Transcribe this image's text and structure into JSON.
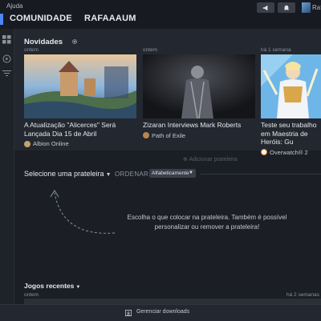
{
  "topbar": {
    "menu_label": "Ajuda",
    "nav_items": [
      "COMUNIDADE",
      "RAFAAAUM"
    ],
    "user_name": "Raf"
  },
  "news": {
    "title": "Novidades",
    "cards": [
      {
        "date": "ontem",
        "title": "A Atualização \"Alicerces\" Será Lançada Dia 15 de Abril",
        "game": "Albion Online"
      },
      {
        "date": "ontem",
        "title": "Zizaran Interviews Mark Roberts",
        "game": "Path of Exile"
      },
      {
        "date": "há 1 semana",
        "title": "Teste seu trabalho em Maestria de Heróis: Gu",
        "game": "Overwatch® 2"
      }
    ]
  },
  "shelf": {
    "add_label": "Adicionar prateleira",
    "select_label": "Selecione uma prateleira",
    "order_label": "ORDENAR:",
    "order_value": "Alfabeticamente",
    "hint": "Escolha o que colocar na prateleira. Também é possível personalizar ou remover a prateleira!"
  },
  "recent": {
    "title": "Jogos recentes",
    "date_left": "ontem",
    "date_right": "há 2 semanas"
  },
  "bottom": {
    "downloads_label": "Gerenciar downloads"
  }
}
